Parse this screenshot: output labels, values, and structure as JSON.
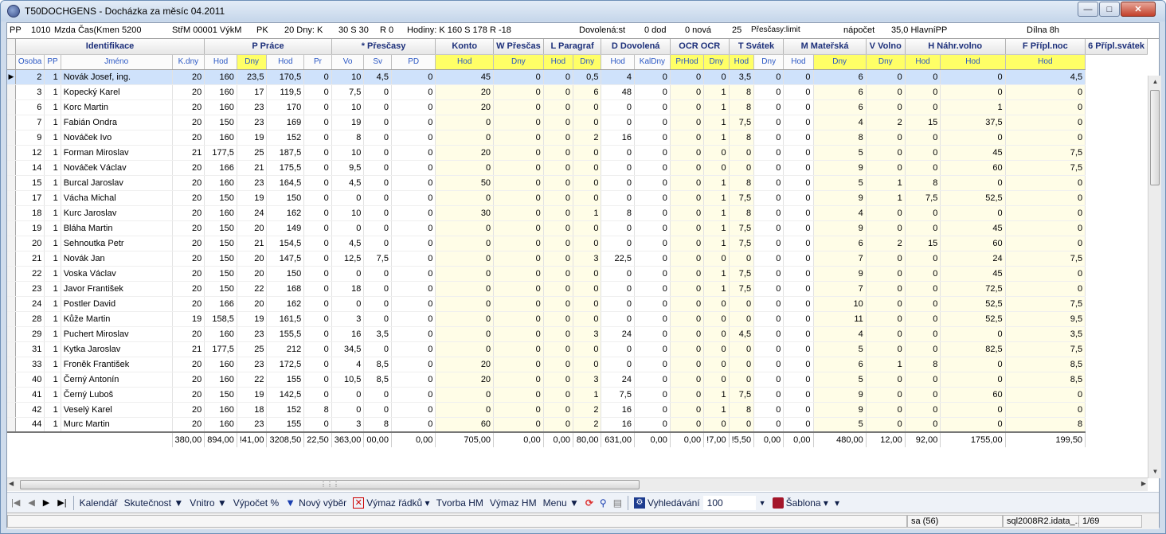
{
  "window": {
    "title": "T50DOCHGENS - Docházka za měsíc 04.2011"
  },
  "infobar": {
    "pp": "PP",
    "pp_value": "1010",
    "mzda": "Mzda Čas(Kmen 5200",
    "strm": "StřM 00001 VýkM",
    "pk": "PK",
    "pk_value": "20 Dny: K",
    "dny_s": "30 S 30",
    "dny_r": "R 0",
    "hodiny": "Hodiny: K 160 S 178 R -18",
    "dovolena": "Dovolená:st",
    "dod": "0 dod",
    "nova": "0 nová",
    "val25": "25",
    "prescasy": "Přesčasy:limit",
    "napocet": "nápočet",
    "hlavni": "35,0 HlavníPP",
    "dilna": "Dílna 8h"
  },
  "groups": [
    "Identifikace",
    "P Práce",
    "* Přesčasy",
    "Konto",
    "W Přesčas",
    "L Paragraf",
    "D Dovolená",
    "OCR OCR",
    "T Svátek",
    "M Mateřská",
    "V Volno",
    "H Náhr.volno",
    "F Přípl.noc",
    "6 Přípl.svátek"
  ],
  "subheaders": [
    "Osoba",
    "PP",
    "Jméno",
    "K.dny",
    "Hod",
    "Dny",
    "Hod",
    "Pr",
    "Vo",
    "Sv",
    "PD",
    "Hod",
    "Dny",
    "Hod",
    "Dny",
    "Hod",
    "KalDny",
    "PrHod",
    "Dny",
    "Hod",
    "Dny",
    "Hod",
    "Dny",
    "Dny",
    "Hod",
    "Hod",
    "Hod"
  ],
  "rows": [
    [
      "2",
      "1",
      "Novák Josef, ing.",
      "20",
      "160",
      "23,5",
      "170,5",
      "0",
      "10",
      "4,5",
      "0",
      "45",
      "0",
      "0",
      "0,5",
      "4",
      "0",
      "0",
      "0",
      "3,5",
      "0",
      "0",
      "6",
      "0",
      "0",
      "0",
      "4,5"
    ],
    [
      "3",
      "1",
      "Kopecký Karel",
      "20",
      "160",
      "17",
      "119,5",
      "0",
      "7,5",
      "0",
      "0",
      "20",
      "0",
      "0",
      "6",
      "48",
      "0",
      "0",
      "1",
      "8",
      "0",
      "0",
      "6",
      "0",
      "0",
      "0",
      "0"
    ],
    [
      "6",
      "1",
      "Korc Martin",
      "20",
      "160",
      "23",
      "170",
      "0",
      "10",
      "0",
      "0",
      "20",
      "0",
      "0",
      "0",
      "0",
      "0",
      "0",
      "1",
      "8",
      "0",
      "0",
      "6",
      "0",
      "0",
      "1",
      "0"
    ],
    [
      "7",
      "1",
      "Fabián Ondra",
      "20",
      "150",
      "23",
      "169",
      "0",
      "19",
      "0",
      "0",
      "0",
      "0",
      "0",
      "0",
      "0",
      "0",
      "0",
      "1",
      "7,5",
      "0",
      "0",
      "4",
      "2",
      "15",
      "37,5",
      "0"
    ],
    [
      "9",
      "1",
      "Nováček Ivo",
      "20",
      "160",
      "19",
      "152",
      "0",
      "8",
      "0",
      "0",
      "0",
      "0",
      "0",
      "2",
      "16",
      "0",
      "0",
      "1",
      "8",
      "0",
      "0",
      "8",
      "0",
      "0",
      "0",
      "0"
    ],
    [
      "12",
      "1",
      "Forman Miroslav",
      "21",
      "177,5",
      "25",
      "187,5",
      "0",
      "10",
      "0",
      "0",
      "20",
      "0",
      "0",
      "0",
      "0",
      "0",
      "0",
      "0",
      "0",
      "0",
      "0",
      "5",
      "0",
      "0",
      "45",
      "7,5"
    ],
    [
      "14",
      "1",
      "Nováček Václav",
      "20",
      "166",
      "21",
      "175,5",
      "0",
      "9,5",
      "0",
      "0",
      "0",
      "0",
      "0",
      "0",
      "0",
      "0",
      "0",
      "0",
      "0",
      "0",
      "0",
      "9",
      "0",
      "0",
      "60",
      "7,5"
    ],
    [
      "15",
      "1",
      "Burcal Jaroslav",
      "20",
      "160",
      "23",
      "164,5",
      "0",
      "4,5",
      "0",
      "0",
      "50",
      "0",
      "0",
      "0",
      "0",
      "0",
      "0",
      "1",
      "8",
      "0",
      "0",
      "5",
      "1",
      "8",
      "0",
      "0"
    ],
    [
      "17",
      "1",
      "Vácha Michal",
      "20",
      "150",
      "19",
      "150",
      "0",
      "0",
      "0",
      "0",
      "0",
      "0",
      "0",
      "0",
      "0",
      "0",
      "0",
      "1",
      "7,5",
      "0",
      "0",
      "9",
      "1",
      "7,5",
      "52,5",
      "0"
    ],
    [
      "18",
      "1",
      "Kurc Jaroslav",
      "20",
      "160",
      "24",
      "162",
      "0",
      "10",
      "0",
      "0",
      "30",
      "0",
      "0",
      "1",
      "8",
      "0",
      "0",
      "1",
      "8",
      "0",
      "0",
      "4",
      "0",
      "0",
      "0",
      "0"
    ],
    [
      "19",
      "1",
      "Bláha Martin",
      "20",
      "150",
      "20",
      "149",
      "0",
      "0",
      "0",
      "0",
      "0",
      "0",
      "0",
      "0",
      "0",
      "0",
      "0",
      "1",
      "7,5",
      "0",
      "0",
      "9",
      "0",
      "0",
      "45",
      "0"
    ],
    [
      "20",
      "1",
      "Sehnoutka Petr",
      "20",
      "150",
      "21",
      "154,5",
      "0",
      "4,5",
      "0",
      "0",
      "0",
      "0",
      "0",
      "0",
      "0",
      "0",
      "0",
      "1",
      "7,5",
      "0",
      "0",
      "6",
      "2",
      "15",
      "60",
      "0"
    ],
    [
      "21",
      "1",
      "Novák Jan",
      "20",
      "150",
      "20",
      "147,5",
      "0",
      "12,5",
      "7,5",
      "0",
      "0",
      "0",
      "0",
      "3",
      "22,5",
      "0",
      "0",
      "0",
      "0",
      "0",
      "0",
      "7",
      "0",
      "0",
      "24",
      "7,5"
    ],
    [
      "22",
      "1",
      "Voska Václav",
      "20",
      "150",
      "20",
      "150",
      "0",
      "0",
      "0",
      "0",
      "0",
      "0",
      "0",
      "0",
      "0",
      "0",
      "0",
      "1",
      "7,5",
      "0",
      "0",
      "9",
      "0",
      "0",
      "45",
      "0"
    ],
    [
      "23",
      "1",
      "Javor František",
      "20",
      "150",
      "22",
      "168",
      "0",
      "18",
      "0",
      "0",
      "0",
      "0",
      "0",
      "0",
      "0",
      "0",
      "0",
      "1",
      "7,5",
      "0",
      "0",
      "7",
      "0",
      "0",
      "72,5",
      "0"
    ],
    [
      "24",
      "1",
      "Postler David",
      "20",
      "166",
      "20",
      "162",
      "0",
      "0",
      "0",
      "0",
      "0",
      "0",
      "0",
      "0",
      "0",
      "0",
      "0",
      "0",
      "0",
      "0",
      "0",
      "10",
      "0",
      "0",
      "52,5",
      "7,5"
    ],
    [
      "28",
      "1",
      "Kůže Martin",
      "19",
      "158,5",
      "19",
      "161,5",
      "0",
      "3",
      "0",
      "0",
      "0",
      "0",
      "0",
      "0",
      "0",
      "0",
      "0",
      "0",
      "0",
      "0",
      "0",
      "11",
      "0",
      "0",
      "52,5",
      "9,5"
    ],
    [
      "29",
      "1",
      "Puchert Miroslav",
      "20",
      "160",
      "23",
      "155,5",
      "0",
      "16",
      "3,5",
      "0",
      "0",
      "0",
      "0",
      "3",
      "24",
      "0",
      "0",
      "0",
      "4,5",
      "0",
      "0",
      "4",
      "0",
      "0",
      "0",
      "3,5"
    ],
    [
      "31",
      "1",
      "Kytka Jaroslav",
      "21",
      "177,5",
      "25",
      "212",
      "0",
      "34,5",
      "0",
      "0",
      "0",
      "0",
      "0",
      "0",
      "0",
      "0",
      "0",
      "0",
      "0",
      "0",
      "0",
      "5",
      "0",
      "0",
      "82,5",
      "7,5"
    ],
    [
      "33",
      "1",
      "Froněk František",
      "20",
      "160",
      "23",
      "172,5",
      "0",
      "4",
      "8,5",
      "0",
      "20",
      "0",
      "0",
      "0",
      "0",
      "0",
      "0",
      "0",
      "0",
      "0",
      "0",
      "6",
      "1",
      "8",
      "0",
      "8,5"
    ],
    [
      "40",
      "1",
      "Černý Antonín",
      "20",
      "160",
      "22",
      "155",
      "0",
      "10,5",
      "8,5",
      "0",
      "20",
      "0",
      "0",
      "3",
      "24",
      "0",
      "0",
      "0",
      "0",
      "0",
      "0",
      "5",
      "0",
      "0",
      "0",
      "8,5"
    ],
    [
      "41",
      "1",
      "Černý Luboš",
      "20",
      "150",
      "19",
      "142,5",
      "0",
      "0",
      "0",
      "0",
      "0",
      "0",
      "0",
      "1",
      "7,5",
      "0",
      "0",
      "1",
      "7,5",
      "0",
      "0",
      "9",
      "0",
      "0",
      "60",
      "0"
    ],
    [
      "42",
      "1",
      "Veselý Karel",
      "20",
      "160",
      "18",
      "152",
      "8",
      "0",
      "0",
      "0",
      "0",
      "0",
      "0",
      "2",
      "16",
      "0",
      "0",
      "1",
      "8",
      "0",
      "0",
      "9",
      "0",
      "0",
      "0",
      "0"
    ],
    [
      "44",
      "1",
      "Murc Martin",
      "20",
      "160",
      "23",
      "155",
      "0",
      "3",
      "8",
      "0",
      "60",
      "0",
      "0",
      "2",
      "16",
      "0",
      "0",
      "0",
      "0",
      "0",
      "0",
      "5",
      "0",
      "0",
      "0",
      "8"
    ]
  ],
  "totals": [
    "380,00",
    "894,00",
    "!41,00",
    "3208,50",
    "22,50",
    "363,00",
    "00,00",
    "0,00",
    "705,00",
    "0,00",
    "0,00",
    "80,00",
    "631,00",
    "0,00",
    "0,00",
    "!7,00",
    "!5,50",
    "0,00",
    "0,00",
    "480,00",
    "12,00",
    "92,00",
    "1755,00",
    "199,50"
  ],
  "toolbar": {
    "kalendar": "Kalendář",
    "skutecnost": "Skutečnost ▼",
    "vnitro": "Vnitro ▼",
    "vypocet": "Výpočet %",
    "novy_vyber": "Nový výběr",
    "vymaz_radku": "Výmaz řádků ▾",
    "tvorba_hm": "Tvorba HM",
    "vymaz_hm": "Výmaz HM",
    "menu": "Menu ▼",
    "vyhledavani": "Vyhledávání",
    "vyhledavani_value": "100",
    "sablona": "Šablona ▾"
  },
  "status": {
    "user": "sa (56)",
    "db": "sql2008R2.idata_...",
    "page": "1/69"
  }
}
